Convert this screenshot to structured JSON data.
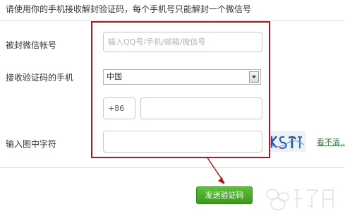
{
  "instruction": "请使用你的手机接收解封验证码，每个手机号只能解封一个微信号",
  "form": {
    "account_label": "被封微信帐号",
    "account_placeholder": "输入QQ号/手机/邮箱/微信号",
    "phone_label": "接收验证码的手机",
    "country_value": "中国",
    "country_code": "+86",
    "phone_value": "",
    "captcha_label": "输入图中字符",
    "captcha_value": "",
    "refresh_link": "看不清..."
  },
  "send_button": "发送验证码",
  "colors": {
    "highlight": "#b0171f",
    "button": "#4cae2b",
    "link": "#2a7a3a"
  }
}
